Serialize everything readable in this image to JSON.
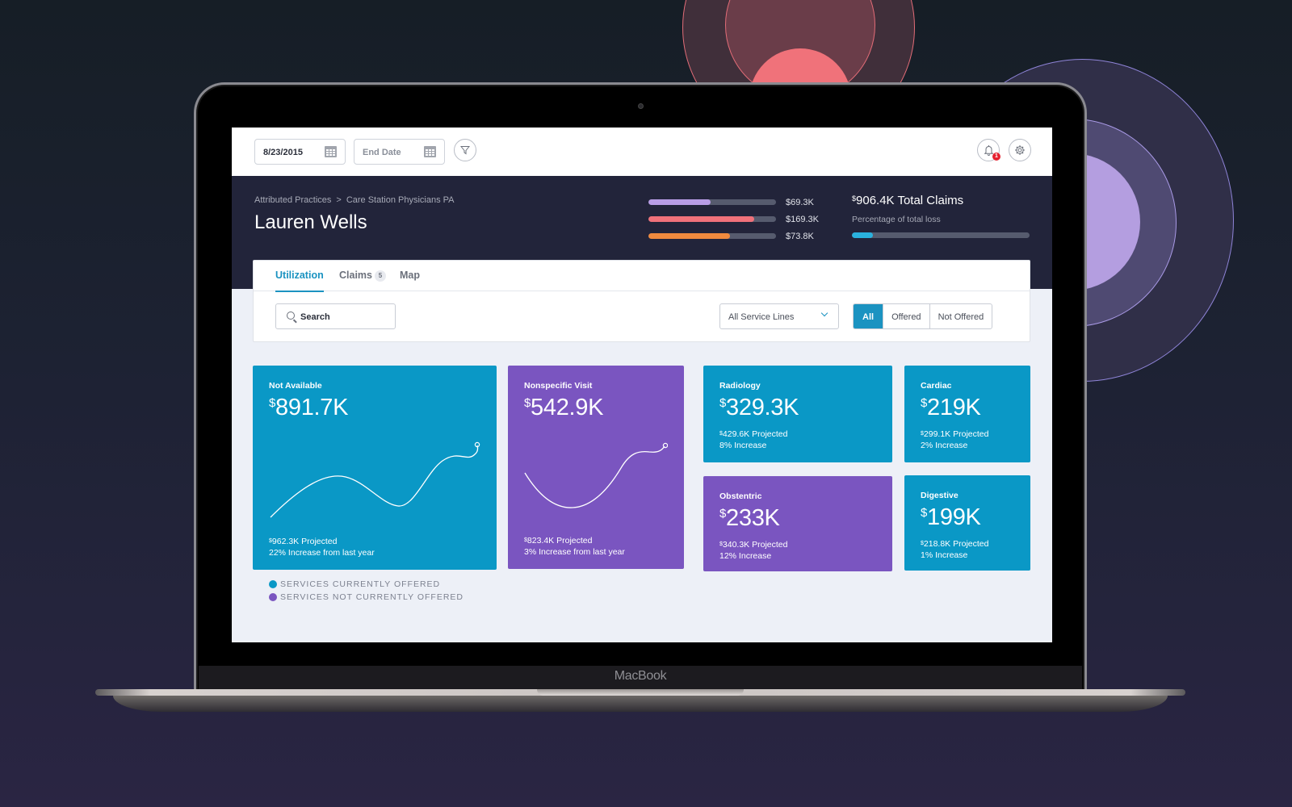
{
  "device": {
    "label": "MacBook"
  },
  "topbar": {
    "start_date": "8/23/2015",
    "end_date_placeholder": "End Date",
    "notification_count": "1",
    "icons": {
      "calendar": "calendar-icon",
      "filter": "filter-icon",
      "bell": "bell-icon",
      "settings": "gear-icon"
    }
  },
  "hero": {
    "breadcrumb": [
      "Attributed Practices",
      "Care Station Physicians PA"
    ],
    "breadcrumb_separator": ">",
    "title": "Lauren Wells",
    "bars": [
      {
        "value": "$69.3K",
        "fill_pct": 49,
        "color": "#b89de6"
      },
      {
        "value": "$169.3K",
        "fill_pct": 83,
        "color": "#f0717a"
      },
      {
        "value": "$73.8K",
        "fill_pct": 64,
        "color": "#f08a3e"
      }
    ],
    "total": {
      "currency": "$",
      "amount": "906.4K Total Claims",
      "subtitle": "Percentage of total loss",
      "fill_pct": 12,
      "color": "#2ab2de"
    }
  },
  "tabs": [
    {
      "label": "Utilization",
      "active": true
    },
    {
      "label": "Claims",
      "badge": "5"
    },
    {
      "label": "Map"
    }
  ],
  "toolbar": {
    "search_placeholder": "Search",
    "service_lines_selected": "All Service Lines",
    "segments": [
      {
        "label": "All",
        "active": true
      },
      {
        "label": "Offered"
      },
      {
        "label": "Not Offered"
      }
    ]
  },
  "cards": [
    {
      "title": "Not Available",
      "currency": "$",
      "value": "891.7K",
      "projected_currency": "$",
      "projected": "962.3K Projected",
      "change": "22% Increase from last year",
      "color": "#0a98c6",
      "offered": true
    },
    {
      "title": "Nonspecific Visit",
      "currency": "$",
      "value": "542.9K",
      "projected_currency": "$",
      "projected": "823.4K Projected",
      "change": "3% Increase from last year",
      "color": "#7a55c0",
      "offered": false
    },
    {
      "title": "Radiology",
      "currency": "$",
      "value": "329.3K",
      "projected_currency": "$",
      "projected": "429.6K Projected",
      "change": "8% Increase",
      "color": "#0a98c6",
      "offered": true
    },
    {
      "title": "Cardiac",
      "currency": "$",
      "value": "219K",
      "projected_currency": "$",
      "projected": "299.1K Projected",
      "change": "2% Increase",
      "color": "#0a98c6",
      "offered": true
    },
    {
      "title": "Obstentric",
      "currency": "$",
      "value": "233K",
      "projected_currency": "$",
      "projected": "340.3K Projected",
      "change": "12% Increase",
      "color": "#7a55c0",
      "offered": false
    },
    {
      "title": "Digestive",
      "currency": "$",
      "value": "199K",
      "projected_currency": "$",
      "projected": "218.8K Projected",
      "change": "1% Increase",
      "color": "#0a98c6",
      "offered": true
    }
  ],
  "legend": [
    {
      "label": "SERVICES CURRENTLY OFFERED",
      "color": "#0a98c6"
    },
    {
      "label": "SERVICES NOT CURRENTLY OFFERED",
      "color": "#7a55c0"
    }
  ]
}
